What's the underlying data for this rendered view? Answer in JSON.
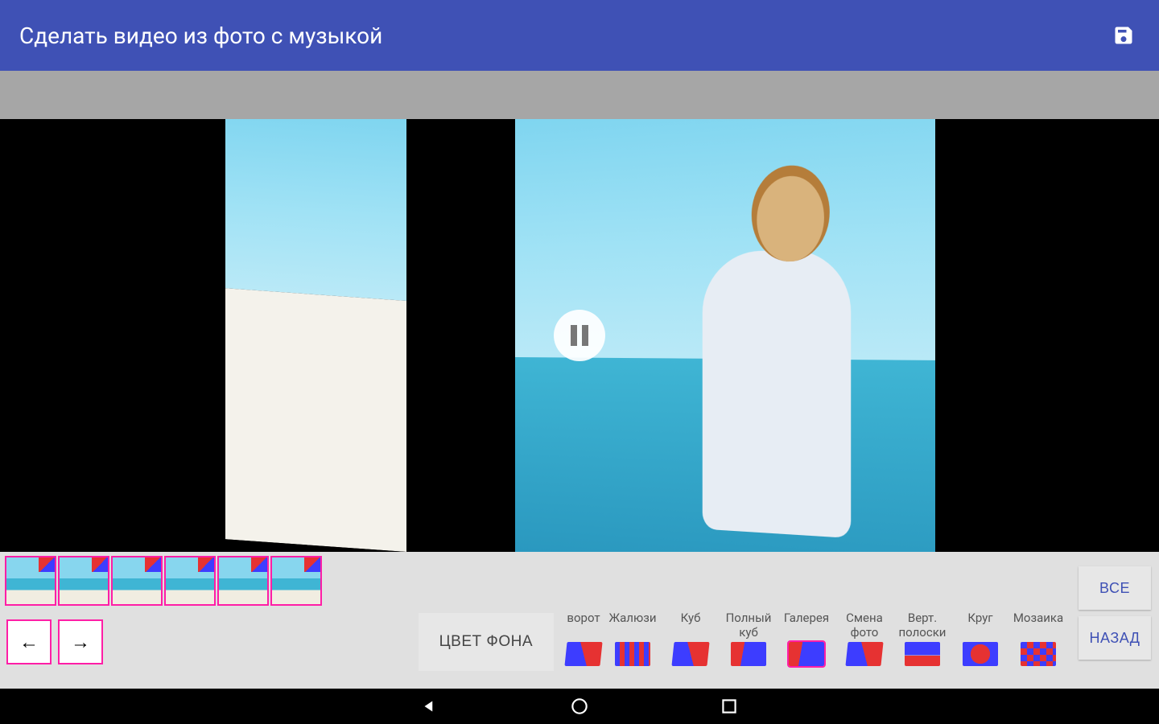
{
  "appbar": {
    "title": "Сделать видео из фото с музыкой"
  },
  "controls": {
    "bg_color_label": "ЦВЕТ ФОНА",
    "all_label": "ВСЕ",
    "back_label": "НАЗАД",
    "prev_arrow": "←",
    "next_arrow": "→"
  },
  "thumbs": [
    0,
    1,
    2,
    3,
    4,
    5
  ],
  "effects": [
    {
      "label": "ворот",
      "label2": "",
      "icon": "cube",
      "partial": true
    },
    {
      "label": "Жалюзи",
      "label2": "",
      "icon": "blinds"
    },
    {
      "label": "Куб",
      "label2": "",
      "icon": "cube"
    },
    {
      "label": "Полный",
      "label2": "куб",
      "icon": "gallery"
    },
    {
      "label": "Галерея",
      "label2": "",
      "icon": "gallery",
      "selected": true
    },
    {
      "label": "Смена",
      "label2": "фото",
      "icon": "cube"
    },
    {
      "label": "Верт.",
      "label2": "полоски",
      "icon": "strips"
    },
    {
      "label": "Круг",
      "label2": "",
      "icon": "circle"
    },
    {
      "label": "Мозаика",
      "label2": "",
      "icon": "mosaic"
    }
  ]
}
